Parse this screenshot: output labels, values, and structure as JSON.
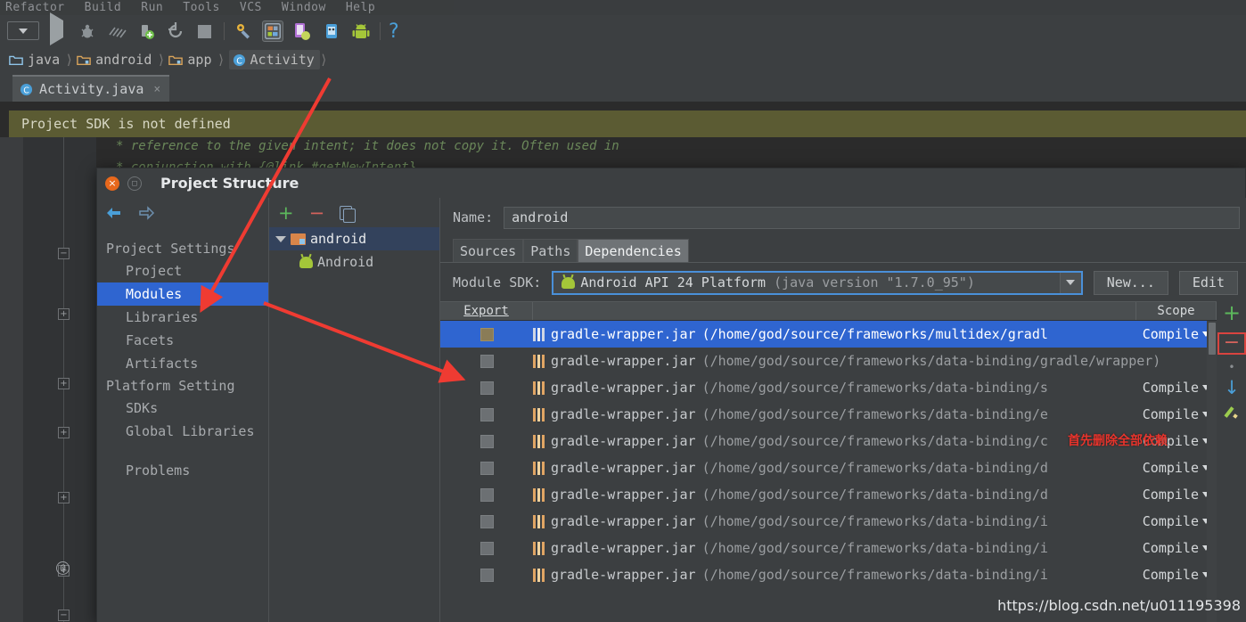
{
  "ide": {
    "menus": [
      {
        "label": "Refactor"
      },
      {
        "label": "Build"
      },
      {
        "label": "Run"
      },
      {
        "label": "Tools"
      },
      {
        "label": "VCS"
      },
      {
        "label": "Window"
      },
      {
        "label": "Help"
      }
    ],
    "toolbar_icons": [
      "run-config-dropdown-icon",
      "run-icon",
      "debug-icon",
      "coverage-icon",
      "attach-debugger-icon",
      "rerun-icon",
      "stop-icon",
      "sdk-manager-icon",
      "project-structure-icon",
      "avd-manager-icon",
      "android-monitor-icon",
      "android-device-icon",
      "help-icon"
    ],
    "breadcrumb": [
      {
        "label": "java",
        "icon": "folder-icon"
      },
      {
        "label": "android",
        "icon": "folder-module-icon"
      },
      {
        "label": "app",
        "icon": "folder-module-icon"
      },
      {
        "label": "Activity",
        "icon": "class-icon"
      }
    ],
    "open_tab": {
      "label": "Activity.java",
      "icon": "class-icon",
      "close": "×"
    },
    "banner": "Project SDK is not defined",
    "code_lines": [
      "* reference to the given intent; it does not copy it.  Often used in",
      "* conjunction with {@link #getNewIntent}"
    ],
    "gutter": {
      "at_marker": "@",
      "fold_collapse": "−",
      "fold_expand": "+"
    }
  },
  "dialog": {
    "title": "Project Structure",
    "close_glyph": "×",
    "maximize_glyph": "□",
    "nav_back_icon": "arrow-left-icon",
    "nav_forward_icon": "arrow-right-icon",
    "nav": {
      "groups": [
        {
          "label": "Project Settings",
          "items": [
            {
              "label": "Project",
              "selected": false
            },
            {
              "label": "Modules",
              "selected": true
            },
            {
              "label": "Libraries",
              "selected": false
            },
            {
              "label": "Facets",
              "selected": false
            },
            {
              "label": "Artifacts",
              "selected": false
            }
          ]
        },
        {
          "label": "Platform Setting",
          "items": [
            {
              "label": "SDKs",
              "selected": false
            },
            {
              "label": "Global Libraries",
              "selected": false
            }
          ]
        }
      ],
      "problems": "Problems"
    },
    "tree": {
      "toolbar": [
        {
          "icon": "plus-icon",
          "glyph": "+"
        },
        {
          "icon": "minus-icon",
          "glyph": "−"
        },
        {
          "icon": "copy-icon"
        }
      ],
      "nodes": [
        {
          "label": "android",
          "icon": "folder-module-icon",
          "selected": true,
          "expanded": true,
          "arrow": "triangle-down-icon"
        },
        {
          "label": "Android",
          "icon": "android-facet-icon",
          "selected": false,
          "child": true
        }
      ]
    },
    "detail": {
      "name_label": "Name:",
      "name_value": "android",
      "tabs": [
        {
          "label": "Sources",
          "active": false
        },
        {
          "label": "Paths",
          "active": false
        },
        {
          "label": "Dependencies",
          "active": true
        }
      ],
      "sdk_label": "Module SDK:",
      "sdk_value": "Android API 24 Platform",
      "sdk_value_dim": "(java version \"1.7.0_95\")",
      "sdk_icon": "android-sdk-icon",
      "sdk_dropdown_icon": "chevron-down-icon",
      "buttons": [
        {
          "label": "New...",
          "name": "new-sdk-button"
        },
        {
          "label": "Edit",
          "name": "edit-sdk-button"
        }
      ]
    },
    "table": {
      "headers": {
        "export": "Export",
        "middle": "",
        "scope": "Scope"
      },
      "scope_value": "Compile",
      "rows": [
        {
          "checked": false,
          "name": "gradle-wrapper.jar",
          "path": "(/home/god/source/frameworks/multidex/gradl",
          "scope": "Compile",
          "selected": true,
          "show_scope": true
        },
        {
          "checked": false,
          "name": "gradle-wrapper.jar",
          "path": "(/home/god/source/frameworks/data-binding/gradle/wrapper)",
          "scope": "",
          "selected": false,
          "show_scope": false
        },
        {
          "checked": false,
          "name": "gradle-wrapper.jar",
          "path": "(/home/god/source/frameworks/data-binding/s",
          "scope": "Compile",
          "selected": false,
          "show_scope": true
        },
        {
          "checked": false,
          "name": "gradle-wrapper.jar",
          "path": "(/home/god/source/frameworks/data-binding/e",
          "scope": "Compile",
          "selected": false,
          "show_scope": true
        },
        {
          "checked": false,
          "name": "gradle-wrapper.jar",
          "path": "(/home/god/source/frameworks/data-binding/c",
          "scope": "Compile",
          "selected": false,
          "show_scope": true
        },
        {
          "checked": false,
          "name": "gradle-wrapper.jar",
          "path": "(/home/god/source/frameworks/data-binding/d",
          "scope": "Compile",
          "selected": false,
          "show_scope": true
        },
        {
          "checked": false,
          "name": "gradle-wrapper.jar",
          "path": "(/home/god/source/frameworks/data-binding/d",
          "scope": "Compile",
          "selected": false,
          "show_scope": true
        },
        {
          "checked": false,
          "name": "gradle-wrapper.jar",
          "path": "(/home/god/source/frameworks/data-binding/i",
          "scope": "Compile",
          "selected": false,
          "show_scope": true
        },
        {
          "checked": false,
          "name": "gradle-wrapper.jar",
          "path": "(/home/god/source/frameworks/data-binding/i",
          "scope": "Compile",
          "selected": false,
          "show_scope": true
        },
        {
          "checked": false,
          "name": "gradle-wrapper.jar",
          "path": "(/home/god/source/frameworks/data-binding/i",
          "scope": "Compile",
          "selected": false,
          "show_scope": true
        }
      ],
      "tools": [
        {
          "icon": "add-dependency-icon",
          "glyph": "+"
        },
        {
          "icon": "remove-dependency-icon",
          "glyph": "−",
          "highlighted": true
        },
        {
          "icon": "move-down-icon",
          "glyph": "↓"
        },
        {
          "icon": "edit-dependency-icon"
        }
      ]
    }
  },
  "annotations": {
    "red_note": "首先删除全部依赖",
    "watermark": "https://blog.csdn.net/u011195398",
    "arrow_color": "#ef3b32"
  }
}
